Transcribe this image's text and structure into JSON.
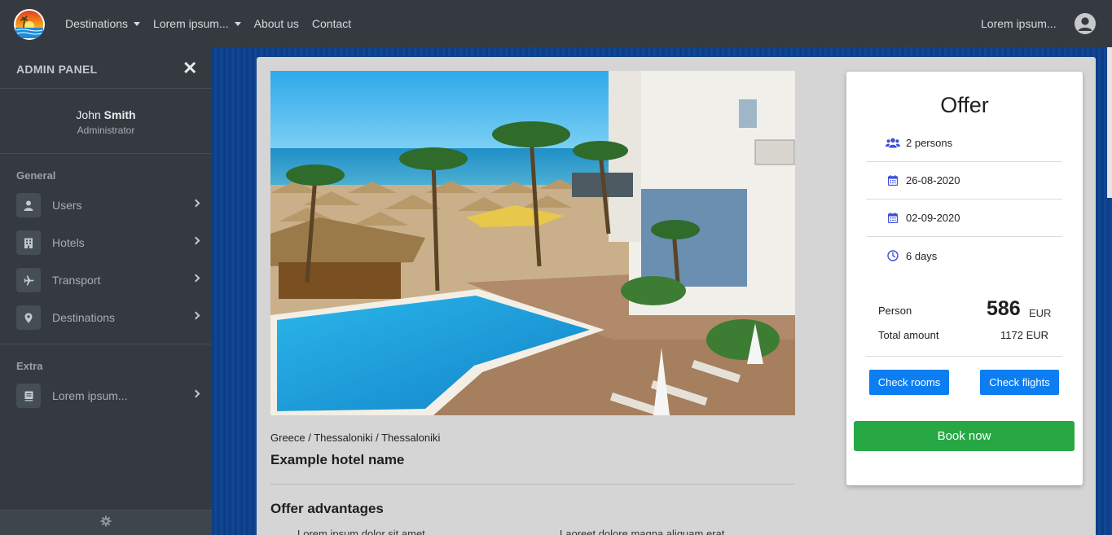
{
  "navbar": {
    "menu": [
      {
        "label": "Destinations",
        "has_dropdown": true
      },
      {
        "label": "Lorem ipsum...",
        "has_dropdown": true
      },
      {
        "label": "About us",
        "has_dropdown": false
      },
      {
        "label": "Contact",
        "has_dropdown": false
      }
    ],
    "right_text": "Lorem ipsum...",
    "icons": {
      "logo": "sunset-beach-logo",
      "account": "user-circle-icon"
    }
  },
  "sidebar": {
    "title": "ADMIN PANEL",
    "user": {
      "first_name": "John",
      "last_name": "Smith",
      "role": "Administrator"
    },
    "sections": [
      {
        "title": "General",
        "items": [
          {
            "label": "Users",
            "icon": "user-icon"
          },
          {
            "label": "Hotels",
            "icon": "building-icon"
          },
          {
            "label": "Transport",
            "icon": "plane-icon"
          },
          {
            "label": "Destinations",
            "icon": "map-marker-icon"
          }
        ]
      },
      {
        "title": "Extra",
        "items": [
          {
            "label": "Lorem ipsum...",
            "icon": "book-icon"
          }
        ]
      }
    ]
  },
  "hotel": {
    "breadcrumb": "Greece / Thessaloniki / Thessaloniki",
    "name": "Example hotel name",
    "advantages_title": "Offer advantages",
    "advantages": [
      "Lorem ipsum dolor sit amet",
      "Laoreet dolore magna aliquam erat"
    ]
  },
  "offer": {
    "title": "Offer",
    "persons": "2 persons",
    "date_from": "26-08-2020",
    "date_to": "02-09-2020",
    "duration": "6 days",
    "person_label": "Person",
    "person_price": "586",
    "currency": "EUR",
    "total_label": "Total amount",
    "total_value": "1172 EUR",
    "check_rooms": "Check rooms",
    "check_flights": "Check flights",
    "book_now": "Book now"
  },
  "colors": {
    "navbar": "#343a40",
    "primary": "#0d7ef2",
    "success": "#28a745",
    "icon_accent": "#3b4fd8"
  }
}
